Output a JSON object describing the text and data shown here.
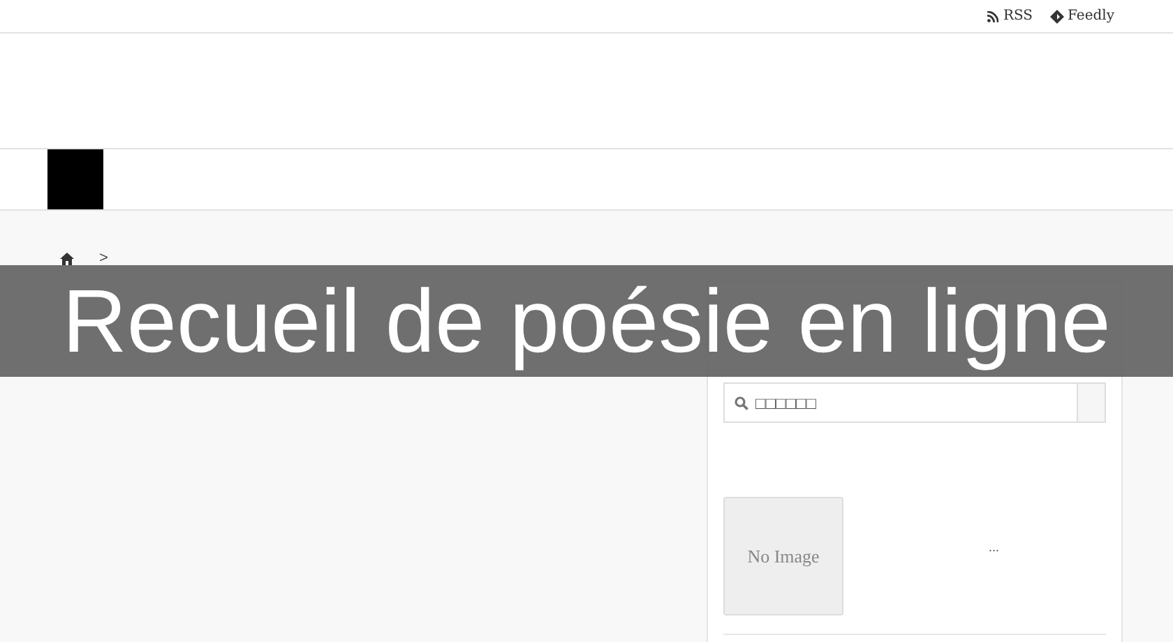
{
  "top_links": [
    {
      "kind": "rss",
      "label": "RSS"
    },
    {
      "kind": "feedly",
      "label": "Feedly"
    }
  ],
  "breadcrumb": {
    "separator": ">"
  },
  "banner": {
    "title": "Recueil de poésie en ligne"
  },
  "sidebar": {
    "search": {
      "placeholder": "□□□□□□"
    },
    "post": {
      "thumbnail": "No Image",
      "excerpt": "..."
    }
  }
}
